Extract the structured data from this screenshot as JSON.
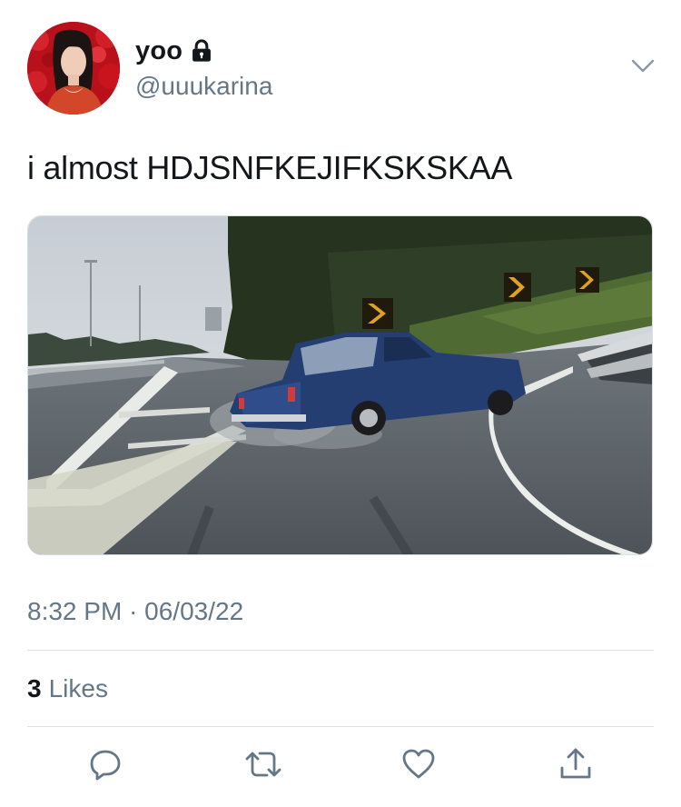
{
  "user": {
    "display_name": "yoo",
    "handle": "@uuukarina",
    "protected_icon": "lock-icon"
  },
  "tweet": {
    "text": "i almost HDJSNFKEJIFKSKSKAA",
    "media_type": "video-thumbnail",
    "timestamp": "8:32 PM · 06/03/22"
  },
  "stats": {
    "likes_count": "3",
    "likes_label": "Likes"
  },
  "actions": {
    "icons": [
      "reply-icon",
      "retweet-icon",
      "like-icon",
      "share-icon"
    ]
  },
  "colors": {
    "text_primary": "#14171a",
    "text_secondary": "#657786",
    "divider": "#dfe3e7"
  }
}
